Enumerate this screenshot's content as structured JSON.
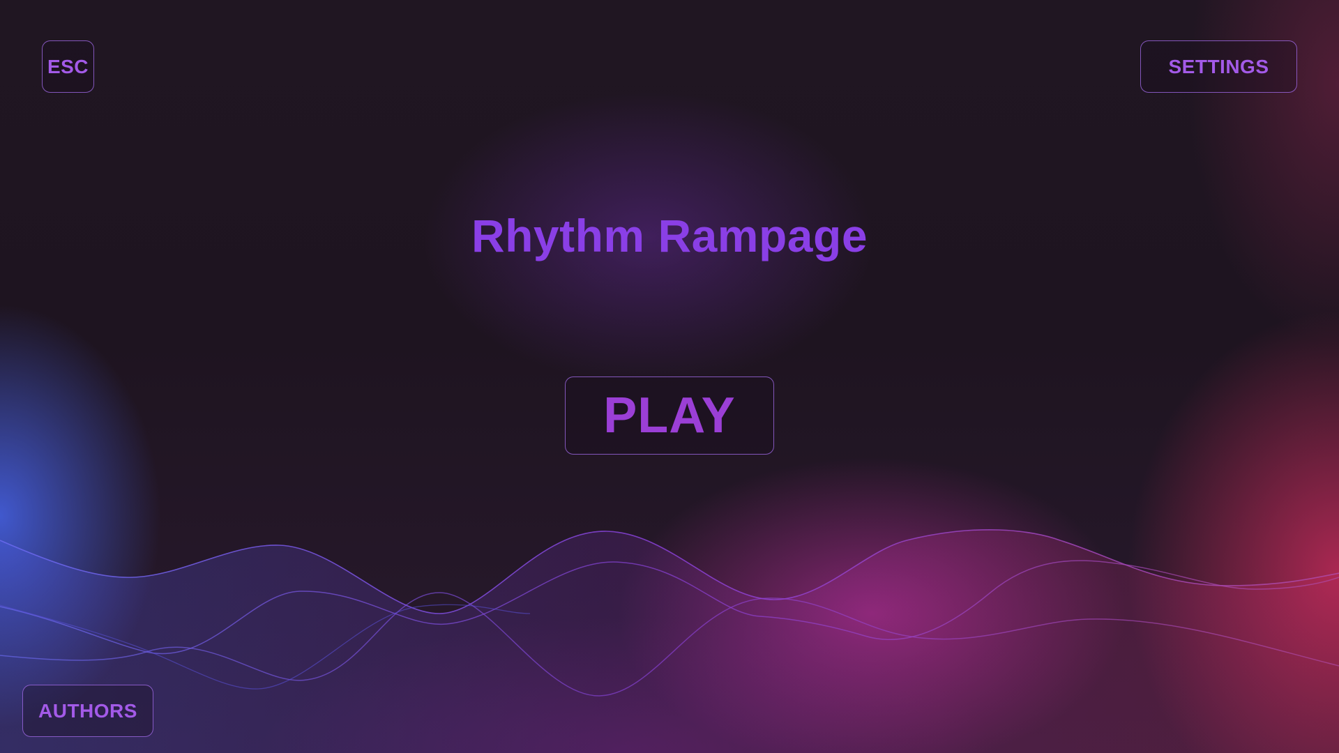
{
  "game": {
    "title": "Rhythm Rampage"
  },
  "menu": {
    "esc_label": "ESC",
    "settings_label": "SETTINGS",
    "play_label": "PLAY",
    "authors_label": "AUTHORS"
  },
  "colors": {
    "accent": "#8a3fe6",
    "play_text": "#9b3fd6",
    "button_border": "#a56ef0",
    "background": "#1f1623",
    "glow_blue": "#4664eb",
    "glow_pink": "#d232aa",
    "glow_red": "#d72d5f"
  }
}
